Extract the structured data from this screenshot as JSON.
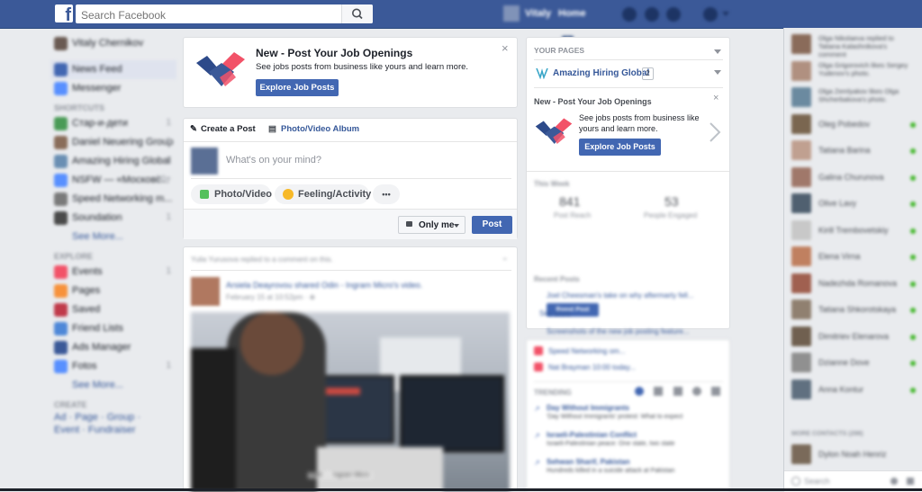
{
  "topbar": {
    "logo_letter": "f",
    "search_placeholder": "Search Facebook",
    "profile_name": "Vitaly",
    "home_label": "Home",
    "home_badge": "2"
  },
  "sidebar": {
    "profile_name": "Vitaly Chernikov",
    "items": [
      {
        "label": "News Feed",
        "color": "#4267b2"
      },
      {
        "label": "Messenger",
        "color": "#5890ff"
      }
    ],
    "shortcuts_heading": "SHORTCUTS",
    "shortcuts": [
      {
        "label": "Стар-и-дети",
        "count": "1",
        "color": "#4a9b56"
      },
      {
        "label": "Daniel Neuering Group",
        "count": "1",
        "color": "#8a6d5a"
      },
      {
        "label": "Amazing Hiring Global",
        "count": "1",
        "color": "#6a8fb3"
      },
      {
        "label": "NSFW — «Московс...",
        "count": "20+",
        "color": "#5890ff"
      },
      {
        "label": "Speed Networking m...",
        "count": "",
        "color": "#7a7a7a"
      },
      {
        "label": "Soundation",
        "count": "1",
        "color": "#4a4a4a"
      }
    ],
    "see_more_1": "See More...",
    "explore_heading": "EXPLORE",
    "explore": [
      {
        "label": "Events",
        "count": "1",
        "color": "#f25268"
      },
      {
        "label": "Pages",
        "count": "",
        "color": "#f7923b"
      },
      {
        "label": "Saved",
        "count": "",
        "color": "#c03a4a"
      },
      {
        "label": "Friend Lists",
        "count": "",
        "color": "#4e88d8"
      },
      {
        "label": "Ads Manager",
        "count": "",
        "color": "#3b5998"
      },
      {
        "label": "Fotos",
        "count": "1",
        "color": "#5890ff"
      }
    ],
    "see_more_2": "See More...",
    "create_heading": "CREATE",
    "create_links": "Ad · Page · Group · Event · Fundraiser"
  },
  "job_promo": {
    "title": "New - Post Your Job Openings",
    "description": "See jobs posts from business like yours and learn more.",
    "button": "Explore Job Posts",
    "close": "×"
  },
  "composer": {
    "tab_create": "Create a Post",
    "tab_album": "Photo/Video Album",
    "placeholder": "What's on your mind?",
    "photo_video": "Photo/Video",
    "feeling": "Feeling/Activity",
    "more": "•••",
    "audience": "Only me",
    "post_button": "Post"
  },
  "feed_post": {
    "story_header": "Yulia Yurusova replied to a comment on this.",
    "author_line": "Arsiela Deayrovou shared Odin - Ingram Micro's video.",
    "timestamp": "February 15 at 10:52pm · ⊕",
    "video_caption": "Odin ↔ Ingram Micro"
  },
  "pages_panel": {
    "heading": "YOUR PAGES",
    "page_name": "Amazing Hiring Global",
    "page_badge": "2",
    "promo_title": "New - Post Your Job Openings",
    "promo_desc": "See jobs posts from business like yours and learn more.",
    "promo_button": "Explore Job Posts",
    "this_week": "This Week",
    "stat1_value": "841",
    "stat1_label": "Post Reach",
    "stat2_value": "53",
    "stat2_label": "People Engaged",
    "recent_posts": "Recent Posts",
    "recent_1": "Joel Cheesman's take on why aftermarty fell...",
    "boost_button": "Boost Post",
    "recent_2": "Screenshots of the new job posting feature...",
    "see_more": "See More"
  },
  "trending_panel": {
    "event_1": "Speed Networking om...",
    "event_2": "Nat Brayman 10:00 today...",
    "heading": "TRENDING",
    "items": [
      {
        "title": "Day Without Immigrants",
        "desc": "'Day Without Immigrants' protest: What to expect"
      },
      {
        "title": "Israeli-Palestinian Conflict",
        "desc": "Israeli-Palestinian peace: One state, two state"
      },
      {
        "title": "Sehwan Sharif, Pakistan",
        "desc": "Hundreds killed in a suicide attack at Pakistan"
      }
    ]
  },
  "chat": {
    "contacts": [
      {
        "name": "Olga Nikolaeva replied to Tatiana Kalashnikova's comment",
        "online": false,
        "color": "#8a6b5a"
      },
      {
        "name": "Olga Grigorovich likes Sergey Yudenov's photo.",
        "online": false,
        "color": "#b09080"
      },
      {
        "name": "Olga Zemlyakov likes Olga Shcherbakova's photo.",
        "online": false,
        "color": "#6b8aa0"
      },
      {
        "name": "Oleg Pobedov",
        "online": true,
        "color": "#7a6650"
      },
      {
        "name": "Tatiana Barina",
        "online": true,
        "color": "#c0a090"
      },
      {
        "name": "Galina Churunova",
        "online": true,
        "color": "#a0786a"
      },
      {
        "name": "Olive Lavy",
        "online": true,
        "color": "#506070"
      },
      {
        "name": "Kirill Trembovetskiy",
        "online": true,
        "color": "#c8c8c8"
      },
      {
        "name": "Elena Virna",
        "online": true,
        "color": "#c08060"
      },
      {
        "name": "Nadezhda Romanova",
        "online": true,
        "color": "#a06050"
      },
      {
        "name": "Tatiana Shkorotskaya",
        "online": true,
        "color": "#908070"
      },
      {
        "name": "Dimitriev Elenarova",
        "online": true,
        "color": "#706050"
      },
      {
        "name": "Dzianne Dove",
        "online": true,
        "color": "#909090"
      },
      {
        "name": "Anna Kontur",
        "online": true,
        "color": "#607080"
      }
    ],
    "more_heading": "MORE CONTACTS (298)",
    "more_contact": "Dylon Noah Henriz",
    "search_placeholder": "Search"
  }
}
